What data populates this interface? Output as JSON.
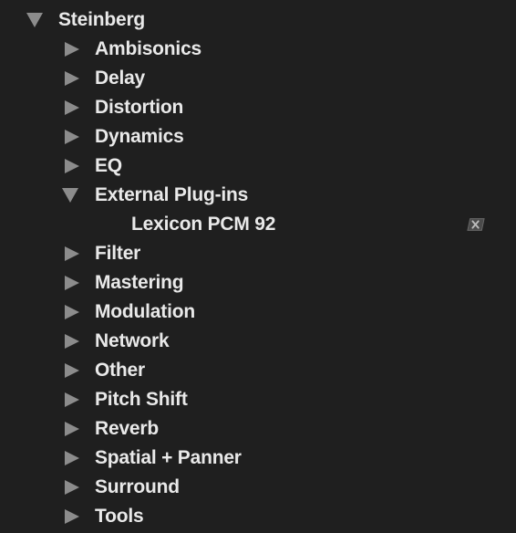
{
  "tree": {
    "root": {
      "label": "Steinberg",
      "expanded": true
    },
    "categories": [
      {
        "label": "Ambisonics",
        "expanded": false
      },
      {
        "label": "Delay",
        "expanded": false
      },
      {
        "label": "Distortion",
        "expanded": false
      },
      {
        "label": "Dynamics",
        "expanded": false
      },
      {
        "label": "EQ",
        "expanded": false
      },
      {
        "label": "External Plug-ins",
        "expanded": true
      },
      {
        "label": "Lexicon PCM 92",
        "is_plugin": true,
        "icon": "external-plugin-icon"
      },
      {
        "label": "Filter",
        "expanded": false
      },
      {
        "label": "Mastering",
        "expanded": false
      },
      {
        "label": "Modulation",
        "expanded": false
      },
      {
        "label": "Network",
        "expanded": false
      },
      {
        "label": "Other",
        "expanded": false
      },
      {
        "label": "Pitch Shift",
        "expanded": false
      },
      {
        "label": "Reverb",
        "expanded": false
      },
      {
        "label": "Spatial + Panner",
        "expanded": false
      },
      {
        "label": "Surround",
        "expanded": false
      },
      {
        "label": "Tools",
        "expanded": false
      }
    ]
  },
  "colors": {
    "background": "#1f1f1f",
    "text": "#e9e9e9",
    "triangle": "#8c8c8c"
  }
}
